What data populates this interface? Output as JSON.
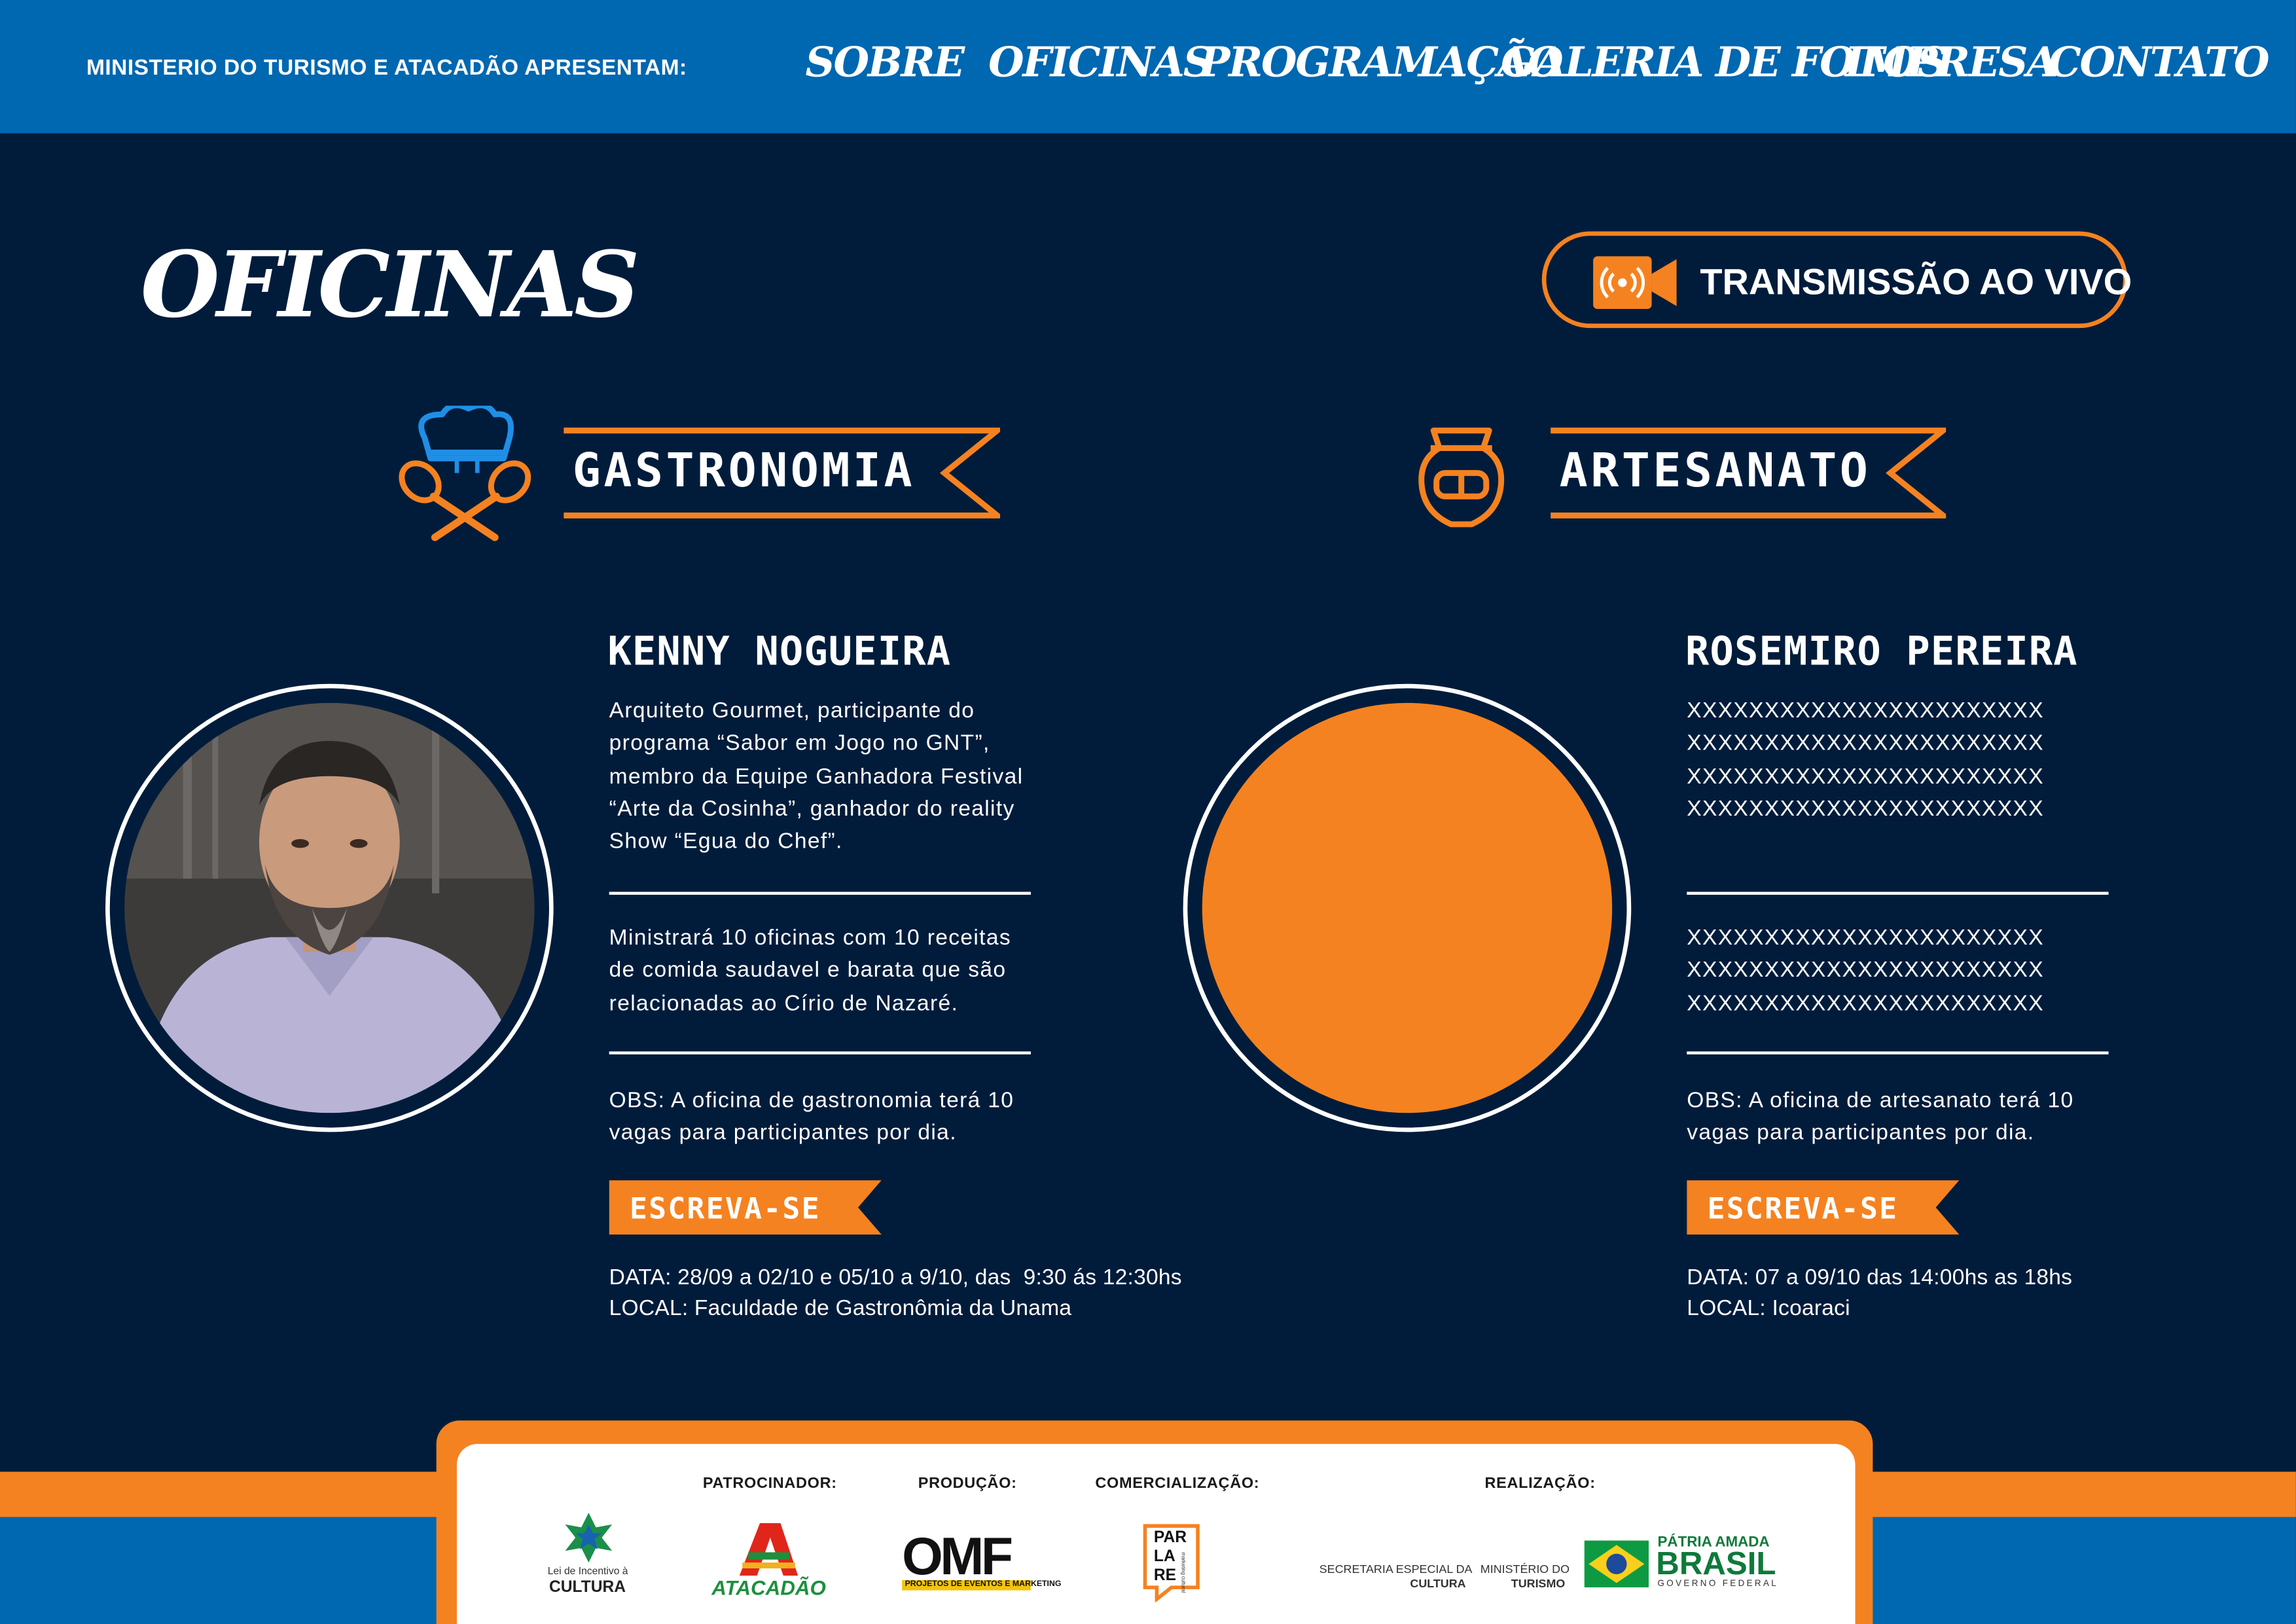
{
  "header": {
    "brand": "MINISTERIO DO TURISMO E ATACADÃO APRESENTAM:",
    "nav": [
      "SOBRE",
      "OFICINAS",
      "PROGRAMAÇÃO",
      "GALERIA DE FOTOS",
      "IMPRESA",
      "CONTATO"
    ]
  },
  "page_title": "OFICINAS",
  "live_button": {
    "label": "TRANSMISSÃO AO VIVO",
    "icon": "live-camera-icon"
  },
  "colors": {
    "navy": "#011c3b",
    "blue": "#0067b1",
    "orange": "#f58220",
    "white": "#ffffff"
  },
  "workshops": [
    {
      "category": "GASTRONOMIA",
      "icon": "chef-hat-spoons-icon",
      "instructor": "KENNY NOGUEIRA",
      "bio": "Arquiteto Gourmet, participante do\nprograma “Sabor em Jogo no GNT”,\nmembro da Equipe Ganhadora Festival\n“Arte da Cosinha”, ganhador do reality\nShow “Egua do Chef”.",
      "description": "Ministrará 10 oficinas com 10 receitas\nde comida saudavel e barata que são\nrelacionadas ao Círio de Nazaré.",
      "obs": "OBS: A oficina de gastronomia terá 10\nvagas para participantes por dia.",
      "cta": "ESCREVA-SE",
      "date": "DATA: 28/09 a 02/10 e 05/10 a 9/10, das  9:30 ás 12:30hs",
      "location": "LOCAL: Faculdade de Gastronômia da Unama"
    },
    {
      "category": "ARTESANATO",
      "icon": "clay-vase-icon",
      "instructor": "ROSEMIRO PEREIRA",
      "bio": "XXXXXXXXXXXXXXXXXXXXXXX\nXXXXXXXXXXXXXXXXXXXXXXX\nXXXXXXXXXXXXXXXXXXXXXXX\nXXXXXXXXXXXXXXXXXXXXXXX",
      "description": "XXXXXXXXXXXXXXXXXXXXXXX\nXXXXXXXXXXXXXXXXXXXXXXX\nXXXXXXXXXXXXXXXXXXXXXXX",
      "obs": "OBS: A oficina de artesanato terá 10\nvagas para participantes por dia.",
      "cta": "ESCREVA-SE",
      "date": "DATA: 07 a 09/10 das 14:00hs as 18hs",
      "location": "LOCAL: Icoaraci"
    }
  ],
  "footer": {
    "labels": [
      "PATROCINADOR:",
      "PRODUÇÃO:",
      "COMERCIALIZAÇÃO:",
      "REALIZAÇÃO:"
    ],
    "lei": {
      "line1": "Lei de Incentivo à",
      "line2": "CULTURA"
    },
    "atacadao": "ATACADÃO",
    "omf": {
      "name": "OMF",
      "tagline": "PROJETOS DE EVENTOS E MARKETING"
    },
    "parlare": {
      "lines": [
        "PAR",
        "LA",
        "RE"
      ],
      "tagline": "marketing cultural"
    },
    "secretaria": {
      "line1": "SECRETARIA ESPECIAL DA",
      "line2": "CULTURA"
    },
    "ministerio": {
      "line1": "MINISTÉRIO DO",
      "line2": "TURISMO"
    },
    "gov": {
      "line1": "PÁTRIA AMADA",
      "line2": "BRASIL",
      "line3": "GOVERNO FEDERAL"
    }
  }
}
